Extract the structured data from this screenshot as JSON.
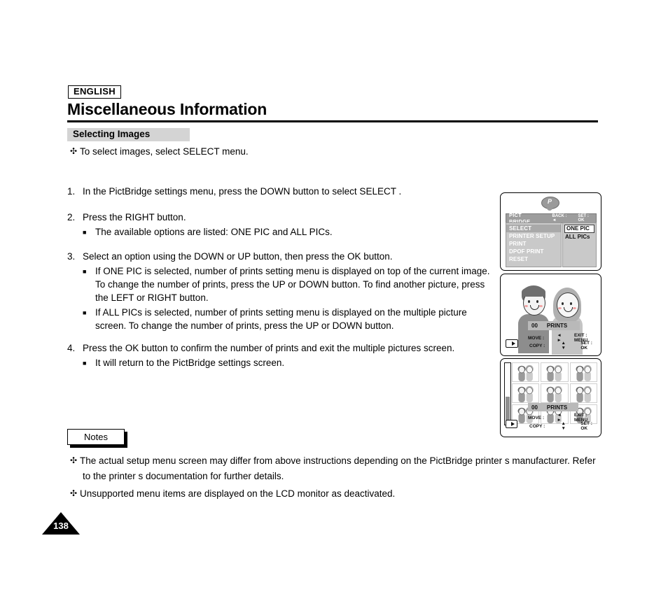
{
  "header": {
    "language_badge": "ENGLISH",
    "title": "Miscellaneous Information"
  },
  "section": {
    "title": "Selecting Images",
    "intro_bullet_marker": "✣",
    "intro_text": "To select images, select  SELECT  menu."
  },
  "steps": [
    {
      "number": "1.",
      "text": "In the PictBridge settings menu, press the DOWN button to select  SELECT .",
      "subs": []
    },
    {
      "number": "2.",
      "text": "Press the RIGHT button.",
      "subs": [
        "The available options are listed: ONE PIC and ALL PICs."
      ]
    },
    {
      "number": "3.",
      "text": "Select an option using the DOWN or UP button, then press the OK button.",
      "subs": [
        "If  ONE PIC  is selected, number of prints setting menu is displayed on top of the current image. To change the number of prints, press the UP or DOWN button. To find another picture, press the LEFT or RIGHT button.",
        "If  ALL PICs  is selected, number of prints setting menu is displayed on the multiple picture screen. To change the number of prints, press the UP or DOWN button."
      ]
    },
    {
      "number": "4.",
      "text": "Press the OK button to confirm the number of prints and exit the multiple pictures screen.",
      "subs": [
        "It will return to the PictBridge settings screen."
      ]
    }
  ],
  "notes": {
    "label": "Notes",
    "marker": "✣",
    "items": [
      "The actual setup menu screen may differ from above instructions depending on the PictBridge printer s manufacturer. Refer",
      "Unsupported menu items are displayed on the LCD monitor as deactivated."
    ],
    "item1_continuation": "to the printer s documentation for further details."
  },
  "page_number": "138",
  "lcd1": {
    "logo_mark": "P",
    "title": "PICT BRIDGE",
    "back_hint": "BACK : ◄",
    "set_hint": "SET : OK",
    "menu_items": [
      "SELECT",
      "PRINTER SETUP",
      "PRINT",
      "DPOF PRINT",
      "RESET"
    ],
    "selected_menu_index": 0,
    "options": [
      "ONE PIC",
      "ALL PICs"
    ],
    "highlighted_option_index": 0
  },
  "lcd2": {
    "prints_count": "00",
    "prints_label": "PRINTS",
    "move_label": "MOVE :",
    "move_icons": "◄ ►",
    "exit_label": "EXIT : MENU",
    "copy_label": "COPY :",
    "copy_icons": "▲ ▼",
    "set_label": "SET : OK",
    "media_icon": "sd-card-icon"
  },
  "lcd3": {
    "prints_count": "00",
    "prints_label": "PRINTS",
    "move_label": "MOVE :",
    "move_icons": "◄ ►",
    "exit_label": "EXIT : MENU",
    "copy_label": "COPY :",
    "copy_icons": "▲ ▼",
    "set_label": "SET : OK",
    "thumbnail_count": 9,
    "media_icon": "sd-card-icon"
  },
  "colors": {
    "band": "#d4d4d4",
    "lcd_gray": "#9d9d9d",
    "lcd_panel": "#c9c9c9"
  }
}
